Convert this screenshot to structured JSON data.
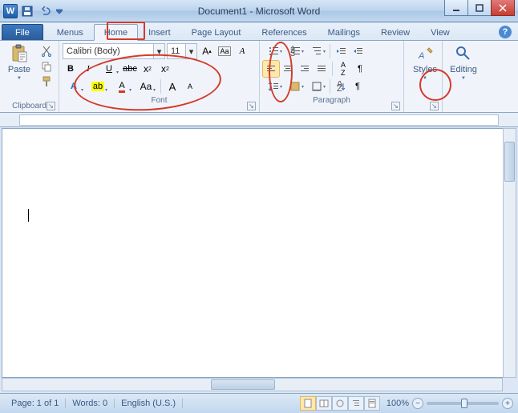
{
  "title": "Document1 - Microsoft Word",
  "qat": {
    "app_letter": "W"
  },
  "tabs": {
    "file": "File",
    "menus": "Menus",
    "home": "Home",
    "insert": "Insert",
    "pagelayout": "Page Layout",
    "references": "References",
    "mailings": "Mailings",
    "review": "Review",
    "view": "View"
  },
  "clipboard": {
    "paste": "Paste",
    "label": "Clipboard"
  },
  "font": {
    "name": "Calibri (Body)",
    "size": "11",
    "label": "Font"
  },
  "paragraph": {
    "label": "Paragraph"
  },
  "styles": {
    "label": "Styles"
  },
  "editing": {
    "label": "Editing"
  },
  "status": {
    "page": "Page: 1 of 1",
    "words": "Words: 0",
    "lang": "English (U.S.)",
    "zoom": "100%"
  }
}
